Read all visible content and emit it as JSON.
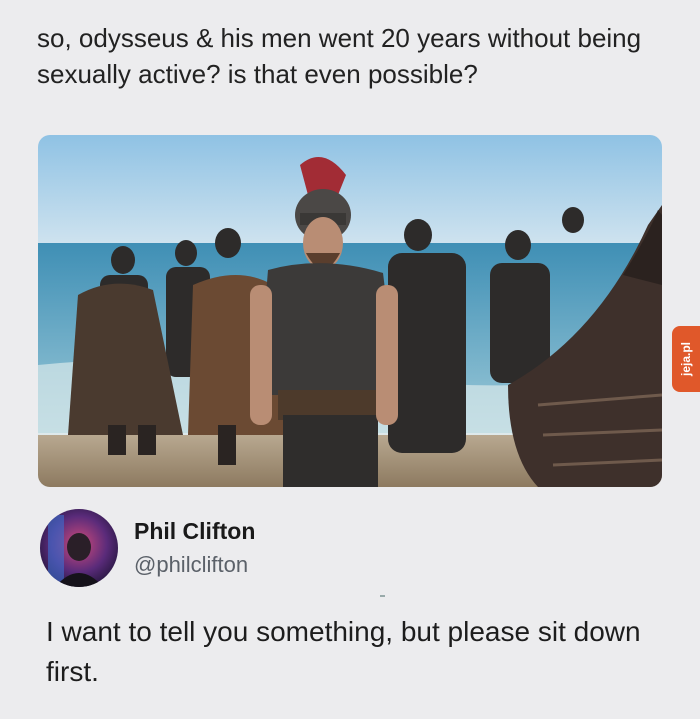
{
  "post": {
    "text": "so, odysseus & his men went 20 years without being sexually active? is that even possible?"
  },
  "image": {
    "subject": "odysseus-warriors-photo"
  },
  "watermark": {
    "label": "jeja.pl",
    "color": "#e0582a"
  },
  "reply": {
    "author_name": "Phil Clifton",
    "author_handle": "@philclifton",
    "text": "I want to tell you something, but please sit down first."
  }
}
